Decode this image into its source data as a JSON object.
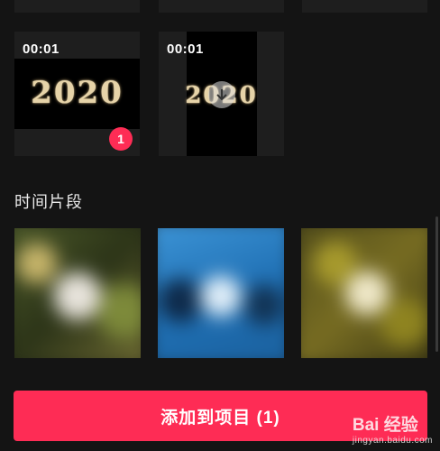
{
  "media": [
    {
      "duration": "",
      "art": ""
    },
    {
      "duration": "",
      "art": ""
    },
    {
      "duration": "",
      "art": ""
    },
    {
      "duration": "00:01",
      "art": "2020",
      "selected_index": "1"
    },
    {
      "duration": "00:01",
      "art": "2020",
      "download": true
    }
  ],
  "section": {
    "title": "时间片段"
  },
  "clips": [
    {
      "theme": "green-blur"
    },
    {
      "theme": "blue-blur"
    },
    {
      "theme": "olive-blur"
    }
  ],
  "footer": {
    "add_button": "添加到项目 (1)"
  },
  "watermark": {
    "brand_text": "Bai 经验",
    "url": "jingyan.baidu.com"
  },
  "colors": {
    "accent": "#fe2c55",
    "background": "#141414"
  }
}
